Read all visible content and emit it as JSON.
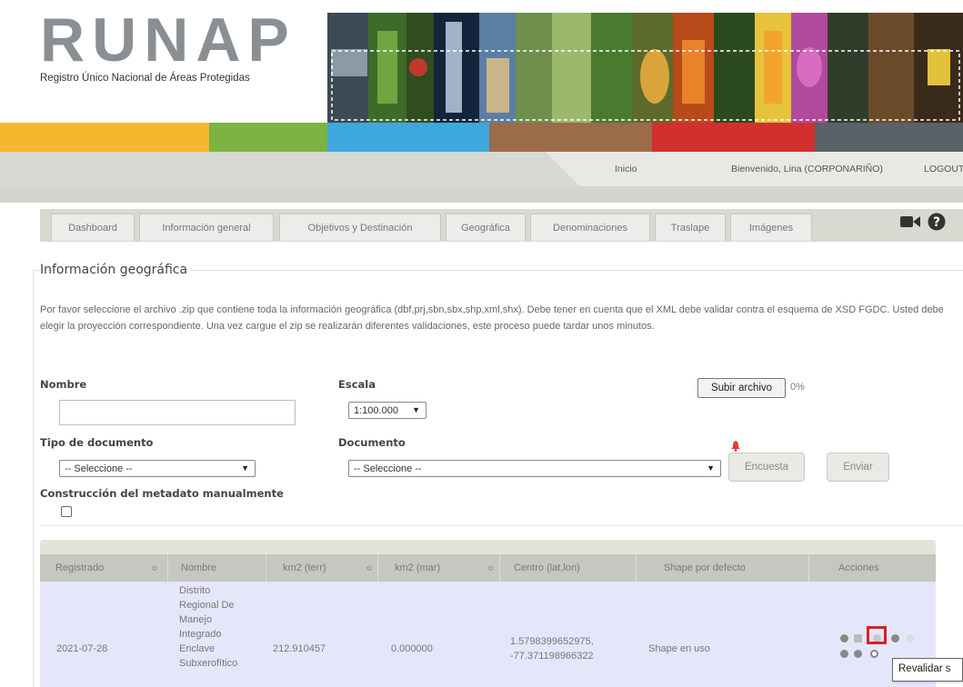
{
  "header": {
    "logo_text": "RUNAP",
    "logo_subtitle": "Registro Único Nacional de Áreas Protegidas"
  },
  "color_bar": [
    "#f4b82e",
    "#7cb342",
    "#3fa8dc",
    "#9b6b4a",
    "#d32f2f",
    "#5b6168"
  ],
  "nav": {
    "inicio": "Inicio",
    "welcome": "Bienvenido, Lina (CORPONARIÑO)",
    "logout": "LOGOUT"
  },
  "tabs": [
    "Dashboard",
    "Información general",
    "Objetivos y Destinación",
    "Geográfica",
    "Denominaciones",
    "Traslape",
    "Imágenes"
  ],
  "icons": [
    "video-camera-icon",
    "help-icon"
  ],
  "section": {
    "title": "Información geográfica",
    "description": "Por favor seleccione el archivo .zip que contiene toda la información geográfica (dbf,prj,sbn,sbx,shp,xml,shx). Debe tener en cuenta que el XML debe validar contra el esquema de XSD FGDC. Usted debe elegir la proyección correspondiente. Una vez cargue el zip se realizarán diferentes validaciones, este proceso puede tardar unos minutos."
  },
  "form": {
    "nombre_label": "Nombre",
    "nombre_value": "",
    "escala_label": "Escala",
    "escala_value": "1:100.000",
    "subir_label": "Subir archivo",
    "progress": "0%",
    "tipo_doc_label": "Tipo de documento",
    "tipo_doc_value": "-- Seleccione --",
    "documento_label": "Documento",
    "documento_value": "-- Seleccione --",
    "encuesta_label": "Encuesta",
    "enviar_label": "Enviar",
    "manual_label": "Construcción del metadato manualmente",
    "manual_checked": false
  },
  "table": {
    "headers": [
      "Registrado",
      "Nombre",
      "km2 (terr)",
      "km2 (mar)",
      "Centro (lat,lon)",
      "Shape por defecto",
      "Acciones"
    ],
    "rows": [
      {
        "registrado": "2021-07-28",
        "nombre_lines": [
          "Distrito",
          "Regional De",
          "Manejo",
          "Integrado",
          "Enclave",
          "Subxerofítico"
        ],
        "km2_terr": "212.910457",
        "km2_mar": "0.000000",
        "centro_lat": "1.5798399652975,",
        "centro_lon": "-77.3711989663​22",
        "shape": "Shape en uso"
      }
    ]
  },
  "tooltip": "Revalidar s"
}
